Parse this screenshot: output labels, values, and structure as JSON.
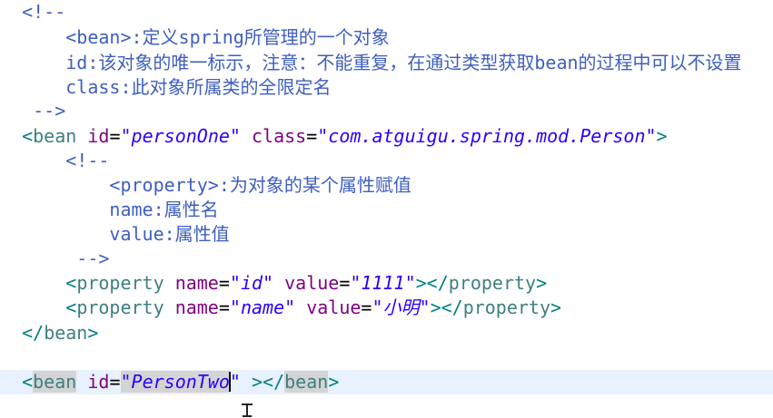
{
  "editor": {
    "lines": [
      [
        [
          "comment",
          "<!--"
        ]
      ],
      [
        [
          "comment",
          "    <bean>:定义spring所管理的一个对象"
        ]
      ],
      [
        [
          "comment",
          "    id:该对象的唯一标示，注意：不能重复，在通过类型获取bean的过程中可以不设置"
        ]
      ],
      [
        [
          "comment",
          "    class:此对象所属类的全限定名"
        ]
      ],
      [
        [
          "comment",
          " -->"
        ]
      ],
      [
        [
          "bracket",
          "<"
        ],
        [
          "tag",
          "bean"
        ],
        [
          "text",
          " "
        ],
        [
          "attr",
          "id"
        ],
        [
          "eq",
          "="
        ],
        [
          "str",
          "\"personOne\""
        ],
        [
          "text",
          " "
        ],
        [
          "attr",
          "class"
        ],
        [
          "eq",
          "="
        ],
        [
          "str",
          "\"com.atguigu.spring.mod.Person\""
        ],
        [
          "bracket",
          ">"
        ]
      ],
      [
        [
          "comment",
          "    <!--"
        ]
      ],
      [
        [
          "comment",
          "        <property>:为对象的某个属性赋值"
        ]
      ],
      [
        [
          "comment",
          "        name:属性名"
        ]
      ],
      [
        [
          "comment",
          "        value:属性值"
        ]
      ],
      [
        [
          "comment",
          "     -->"
        ]
      ],
      [
        [
          "text",
          "    "
        ],
        [
          "bracket",
          "<"
        ],
        [
          "tag",
          "property"
        ],
        [
          "text",
          " "
        ],
        [
          "attr",
          "name"
        ],
        [
          "eq",
          "="
        ],
        [
          "str",
          "\"id\""
        ],
        [
          "text",
          " "
        ],
        [
          "attr",
          "value"
        ],
        [
          "eq",
          "="
        ],
        [
          "str",
          "\"1111\""
        ],
        [
          "bracket",
          "></"
        ],
        [
          "tag",
          "property"
        ],
        [
          "bracket",
          ">"
        ]
      ],
      [
        [
          "text",
          "    "
        ],
        [
          "bracket",
          "<"
        ],
        [
          "tag",
          "property"
        ],
        [
          "text",
          " "
        ],
        [
          "attr",
          "name"
        ],
        [
          "eq",
          "="
        ],
        [
          "str",
          "\"name\""
        ],
        [
          "text",
          " "
        ],
        [
          "attr",
          "value"
        ],
        [
          "eq",
          "="
        ],
        [
          "str",
          "\"小明\""
        ],
        [
          "bracket",
          "></"
        ],
        [
          "tag",
          "property"
        ],
        [
          "bracket",
          ">"
        ]
      ],
      [
        [
          "bracket",
          "</"
        ],
        [
          "tag",
          "bean"
        ],
        [
          "bracket",
          ">"
        ]
      ],
      [],
      [
        [
          "bracket",
          "<"
        ],
        [
          "tag",
          "bean",
          "hl"
        ],
        [
          "text",
          " "
        ],
        [
          "attr",
          "id"
        ],
        [
          "eq",
          "="
        ],
        [
          "str",
          "\"PersonTwo",
          "hl"
        ],
        [
          "caret",
          ""
        ],
        [
          "str",
          "\""
        ],
        [
          "text",
          " "
        ],
        [
          "bracket",
          "></"
        ],
        [
          "tag",
          "bean",
          "hl"
        ],
        [
          "bracket",
          ">"
        ]
      ]
    ],
    "current_line": 15
  }
}
